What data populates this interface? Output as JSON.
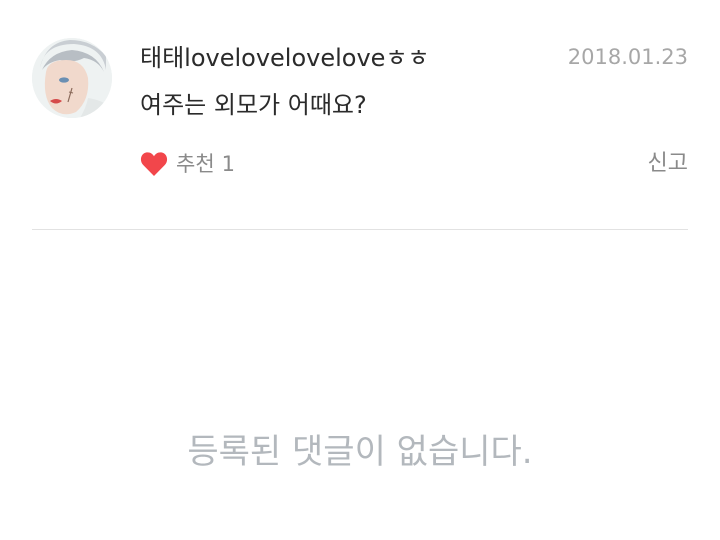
{
  "post": {
    "avatar": "avatar-image",
    "username": "태태loveloveloveloveㅎㅎ",
    "date": "2018.01.23",
    "text": "여주는 외모가 어때요?",
    "like": {
      "icon": "heart-icon",
      "label": "추천",
      "count": "1",
      "color": "#f2464b"
    },
    "report_label": "신고"
  },
  "comments": {
    "empty_message": "등록된 댓글이 없습니다."
  }
}
